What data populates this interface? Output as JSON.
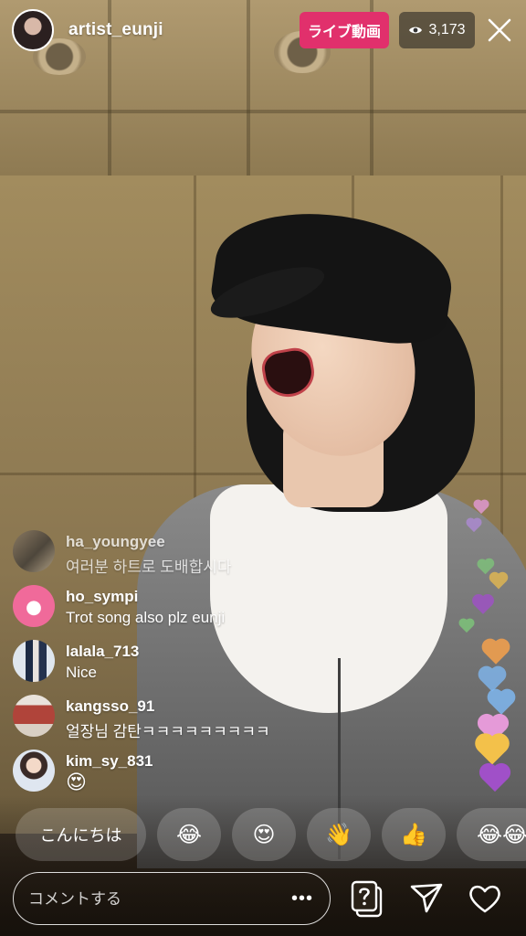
{
  "header": {
    "username": "artist_eunji",
    "live_label": "ライブ動画",
    "viewer_count": "3,173",
    "eye_icon": "eye-icon",
    "close_icon": "close-icon"
  },
  "comments": [
    {
      "user": "ha_youngyee",
      "text": "여러분 하트로 도배합시다"
    },
    {
      "user": "ho_sympi",
      "text": "Trot song also plz eunji"
    },
    {
      "user": "lalala_713",
      "text": "Nice"
    },
    {
      "user": "kangsso_91",
      "text": "얼장님 감탄ㅋㅋㅋㅋㅋㅋㅋㅋㅋ"
    },
    {
      "user": "kim_sy_831",
      "text": "😍"
    }
  ],
  "quick_reactions": {
    "text_chip": "こんにちは",
    "emojis": [
      "😂",
      "😍",
      "👋",
      "👍",
      "😂😂"
    ]
  },
  "bottom_bar": {
    "comment_placeholder": "コメントする",
    "more_label": "•••",
    "icons": [
      "question-card-icon",
      "send-icon",
      "heart-icon"
    ]
  },
  "colors": {
    "live_badge": "#e1306c",
    "hearts": [
      "#e59ad8",
      "#b38be0",
      "#7ec87a",
      "#f3c14a",
      "#f6a14c",
      "#7fb7f0",
      "#a050c8",
      "#e8e8e8"
    ]
  }
}
